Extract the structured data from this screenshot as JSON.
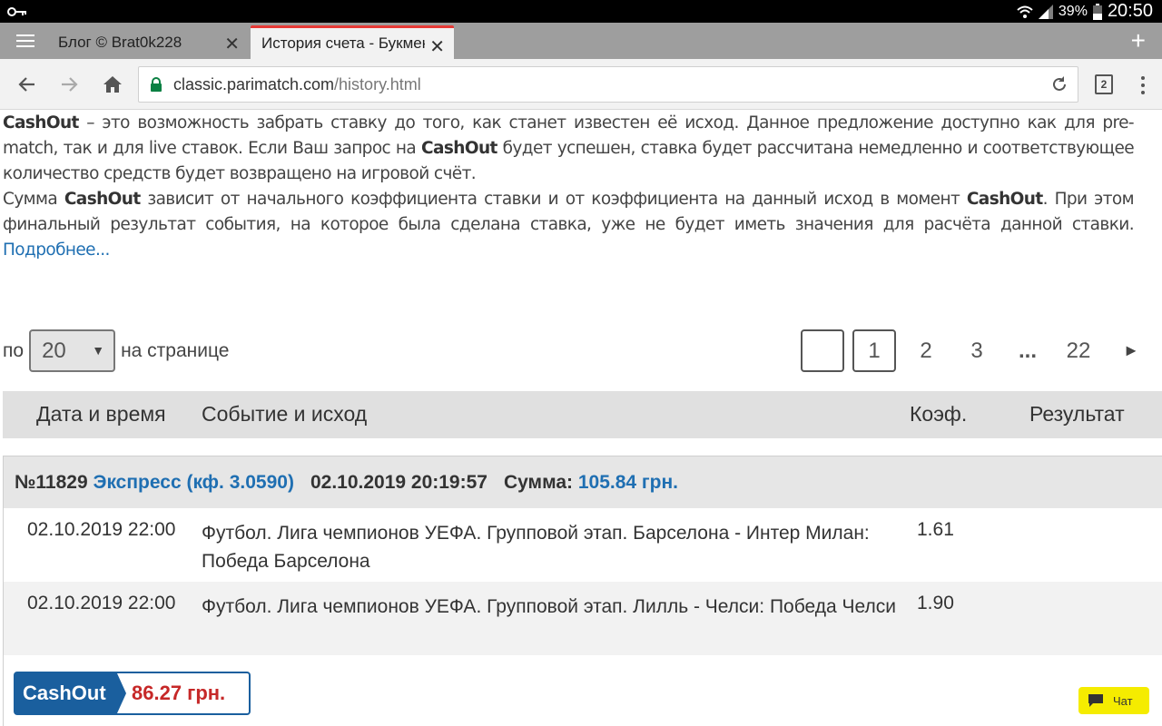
{
  "status": {
    "battery": "39%",
    "time": "20:50"
  },
  "tabs": [
    {
      "title": "Блог © Brat0k228"
    },
    {
      "title": "История счета - Букмекерская контора Париматч"
    }
  ],
  "toolbar": {
    "url_host": "classic.parimatch.com",
    "url_path": "/history.html",
    "tab_count": "2"
  },
  "intro": {
    "p1_bold": "CashOut",
    "p1_text_a": " – это возможность забрать ставку до того, как станет известен её исход. Данное предложение доступно как для pre-match, так и для live ставок. Если Ваш запрос на ",
    "p1_bold_2": "CashOut",
    "p1_text_b": " будет успешен, ставка будет рассчитана немедленно и соответствующее количество средств будет возвращено на игровой счёт.",
    "p2_text_a": "Сумма ",
    "p2_bold": "CashOut",
    "p2_text_b": " зависит от начального коэффициента ставки и от коэффициента на данный исход в момент ",
    "p2_bold_2": "CashOut",
    "p2_text_c": ". При этом финальный результат события, на которое была сделана ставка, уже не будет иметь значения для расчёта данной ставки. ",
    "more_link": "Подробнее..."
  },
  "perpage": {
    "prefix": "по",
    "value": "20",
    "suffix": "на странице"
  },
  "pagination": {
    "blank": "",
    "current": "1",
    "p2": "2",
    "p3": "3",
    "dots": "...",
    "last": "22",
    "next": "►"
  },
  "table": {
    "headers": {
      "date": "Дата и время",
      "event": "Событие и исход",
      "coef": "Коэф.",
      "result": "Результат"
    }
  },
  "bet": {
    "number": "№11829",
    "type": "Экспресс (кф. 3.0590)",
    "datetime": "02.10.2019 20:19:57",
    "sum_label": "Сумма:",
    "sum_value": "105.84 грн.",
    "rows": [
      {
        "date": "02.10.2019 22:00",
        "event": "Футбол. Лига чемпионов УЕФА. Групповой этап. Барселона - Интер Милан: Победа Барселона",
        "coef": "1.61",
        "result": ""
      },
      {
        "date": "02.10.2019 22:00",
        "event": "Футбол. Лига чемпионов УЕФА. Групповой этап. Лилль - Челси: Победа Челси",
        "coef": "1.90",
        "result": ""
      }
    ]
  },
  "cashout": {
    "label": "CashOut",
    "amount": "86.27 грн."
  },
  "chat": {
    "label": "Чат"
  },
  "colors": {
    "accent_blue": "#1f6fb2",
    "cashout_blue": "#1a5f9e",
    "cashout_red": "#c62828",
    "chat_yellow": "#f5ec00",
    "tab_active_border": "#e53935"
  }
}
